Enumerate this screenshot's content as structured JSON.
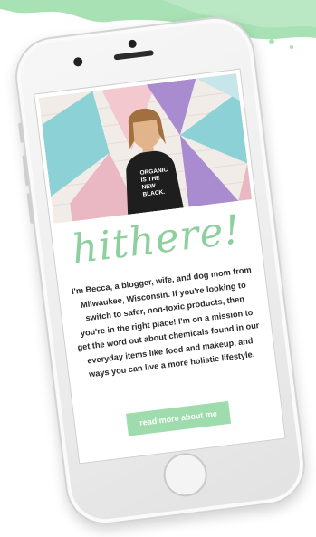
{
  "greeting": "hithere!",
  "bio": "I'm Becca, a blogger, wife, and dog mom from Milwaukee, Wisconsin. If you're looking to switch to safer, non-toxic products, then you're in the right place! I'm on a mission to get the word out about chemicals found in our everyday items like food and makeup, and ways you can live a more holistic lifestyle.",
  "cta_label": "read more about me",
  "shirt_text": [
    "ORGANIC",
    "IS THE",
    "NEW",
    "BLACK."
  ],
  "colors": {
    "accent": "#9fdcad",
    "greeting": "#8ecf9e",
    "brush": "#a8e2b4",
    "mural_purple": "#a98bd0",
    "mural_teal": "#8cd1d6",
    "mural_pink": "#e9b8c2"
  }
}
